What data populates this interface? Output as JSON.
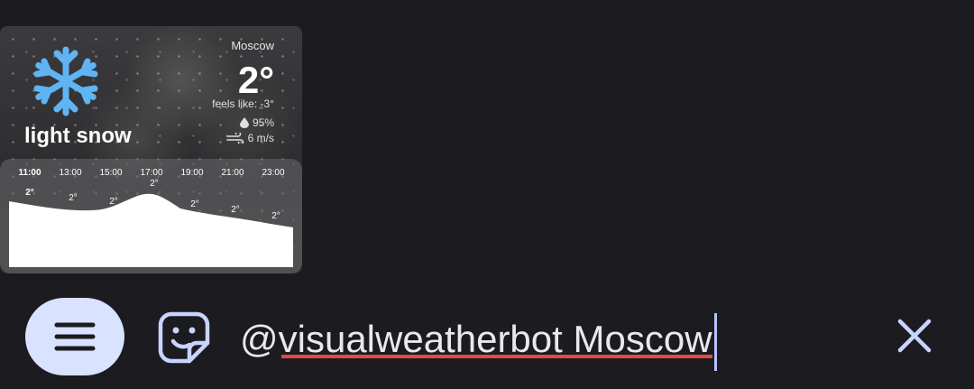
{
  "weather_card": {
    "city": "Moscow",
    "temperature": "2°",
    "feels_like": "feels like: -3°",
    "humidity": "95%",
    "wind": "6 m/s",
    "condition": "light snow",
    "condition_icon": "snowflake-icon",
    "forecast": {
      "hours": [
        "11:00",
        "13:00",
        "15:00",
        "17:00",
        "19:00",
        "21:00",
        "23:00"
      ],
      "temps": [
        "2°",
        "2°",
        "2°",
        "2°",
        "2°",
        "2°",
        "2°"
      ]
    }
  },
  "composer": {
    "text": "@visualweatherbot Moscow",
    "menu_icon": "menu-icon",
    "sticker_icon": "sticker-icon",
    "close_icon": "close-icon",
    "accent_color": "#d9e2ff",
    "spellcheck_color": "#e24a4a"
  }
}
